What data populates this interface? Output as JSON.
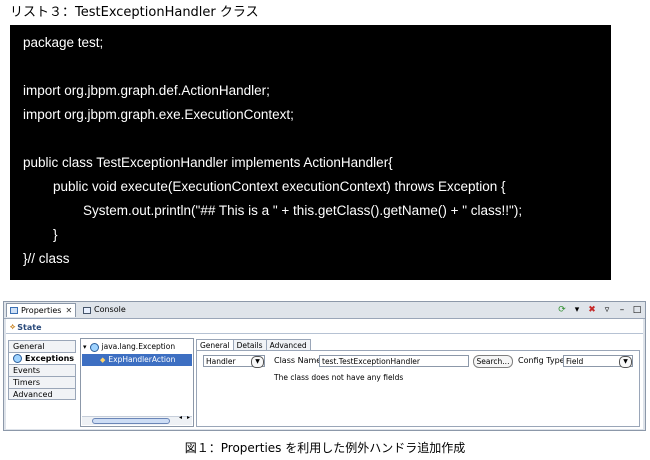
{
  "listing": {
    "title": "リスト３：TestExceptionHandler クラス"
  },
  "code": {
    "lines": [
      "package test;",
      "",
      "import org.jbpm.graph.def.ActionHandler;",
      "import org.jbpm.graph.exe.ExecutionContext;",
      "",
      "public class TestExceptionHandler implements ActionHandler{",
      "        public void execute(ExecutionContext executionContext) throws Exception {",
      "                System.out.println(\"## This is a \" + this.getClass().getName() + \" class!!\");",
      "        }",
      "}// class"
    ]
  },
  "panel": {
    "tabs": [
      {
        "label": "Properties",
        "icon": "properties-icon",
        "active": true
      },
      {
        "label": "Console",
        "icon": "console-icon",
        "active": false
      }
    ],
    "state_title": "State",
    "side_tabs": [
      "General",
      "Exceptions",
      "Events",
      "Timers",
      "Advanced"
    ],
    "active_side_tab": "Exceptions",
    "tree": {
      "items": [
        {
          "label": "java.lang.Exception",
          "expanded": true,
          "selected": false
        },
        {
          "label": "ExpHandlerAction",
          "selected": true
        }
      ]
    },
    "detail_tabs": [
      "General",
      "Details",
      "Advanced"
    ],
    "active_detail_tab": "General",
    "handler_select": "Handler",
    "class_name_label": "Class Name",
    "class_name_value": "test.TestExceptionHandler",
    "search_button": "Search...",
    "config_type_label": "Config Type",
    "config_type_value": "Field",
    "no_fields_text": "The class does not have any fields"
  },
  "caption": "図１：Properties を利用した例外ハンドラ追加作成",
  "colors": {
    "code_bg": "#000000",
    "code_fg": "#ffffff",
    "selection": "#3d6fc2",
    "panel_bg": "#dee3ea"
  }
}
